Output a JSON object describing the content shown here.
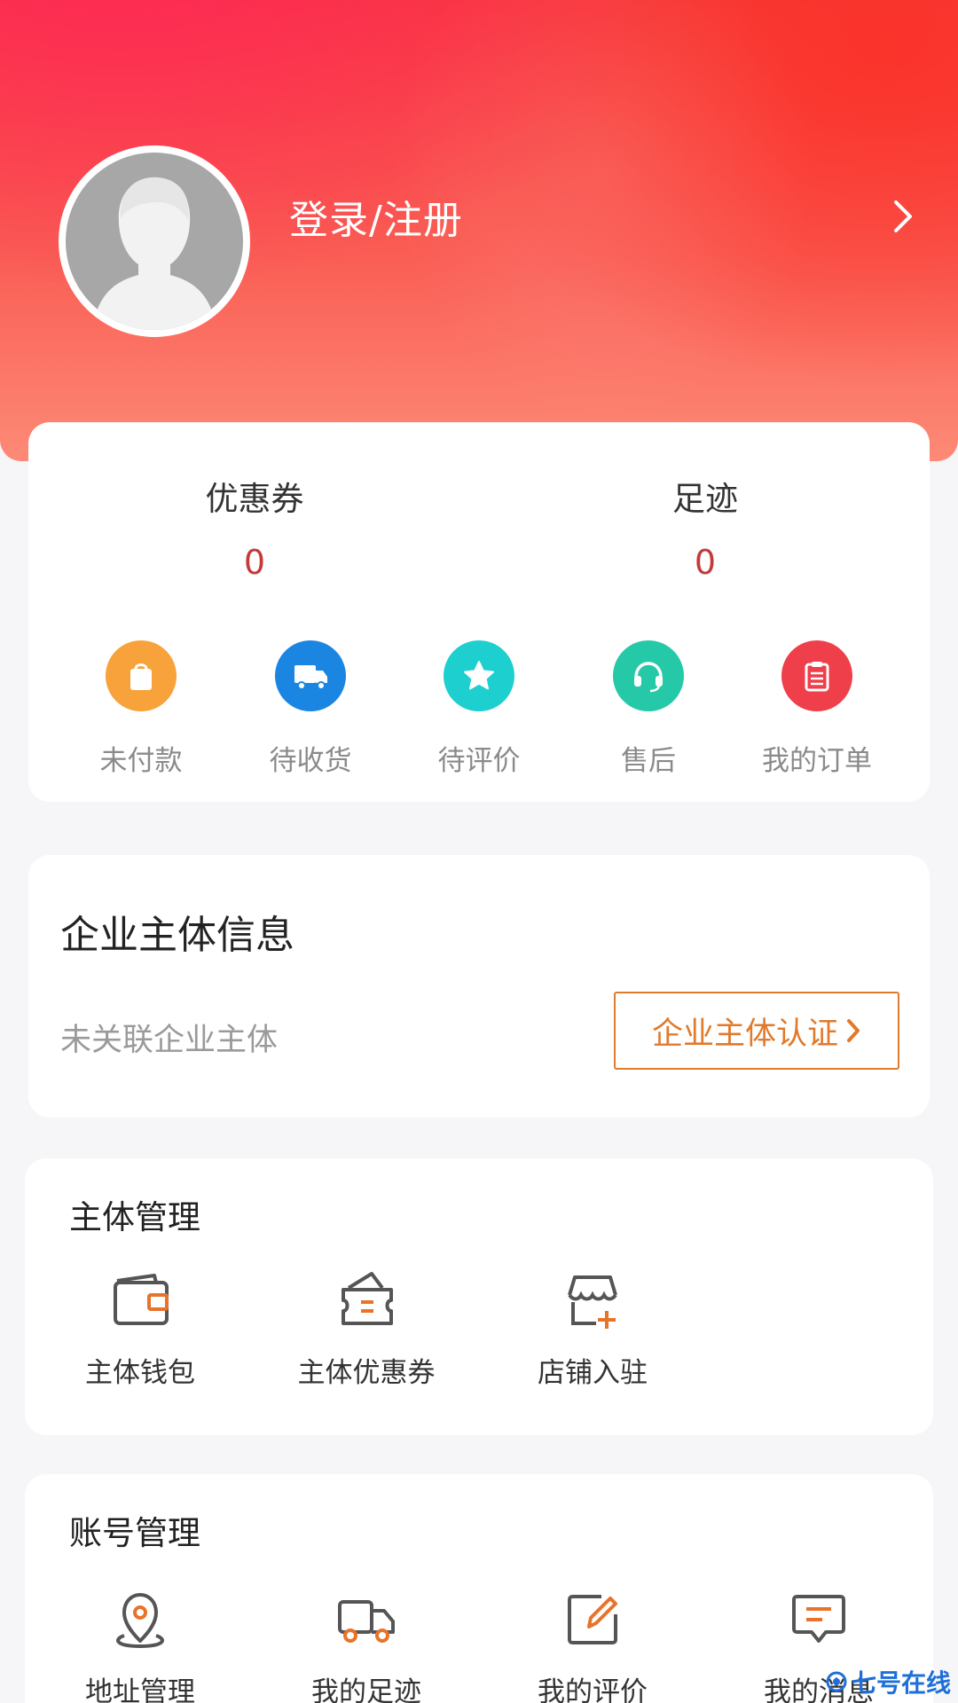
{
  "header": {
    "login_label": "登录/注册",
    "gradient_colors": [
      "#f73a3d",
      "#fa5d54",
      "#fd8a76"
    ]
  },
  "stats": [
    {
      "label": "优惠券",
      "value": "0"
    },
    {
      "label": "足迹",
      "value": "0"
    }
  ],
  "orders": [
    {
      "label": "未付款",
      "icon": "shopping-bag-icon",
      "color": "#f7a23a"
    },
    {
      "label": "待收货",
      "icon": "truck-icon",
      "color": "#1a86e2"
    },
    {
      "label": "待评价",
      "icon": "star-icon",
      "color": "#1dcfcf"
    },
    {
      "label": "售后",
      "icon": "headset-icon",
      "color": "#25c9a8"
    },
    {
      "label": "我的订单",
      "icon": "clipboard-icon",
      "color": "#ee3f4a"
    }
  ],
  "enterprise": {
    "title": "企业主体信息",
    "status": "未关联企业主体",
    "button_label": "企业主体认证",
    "accent": "#e07a2c"
  },
  "subject_management": {
    "title": "主体管理",
    "items": [
      {
        "label": "主体钱包",
        "icon": "wallet-icon"
      },
      {
        "label": "主体优惠券",
        "icon": "coupon-wallet-icon"
      },
      {
        "label": "店铺入驻",
        "icon": "store-add-icon"
      }
    ]
  },
  "account_management": {
    "title": "账号管理",
    "items": [
      {
        "label": "地址管理",
        "icon": "location-pin-icon"
      },
      {
        "label": "我的足迹",
        "icon": "delivery-truck-icon"
      },
      {
        "label": "我的评价",
        "icon": "edit-icon"
      },
      {
        "label": "我的消息",
        "icon": "message-icon"
      }
    ]
  },
  "watermark": "七号在线"
}
